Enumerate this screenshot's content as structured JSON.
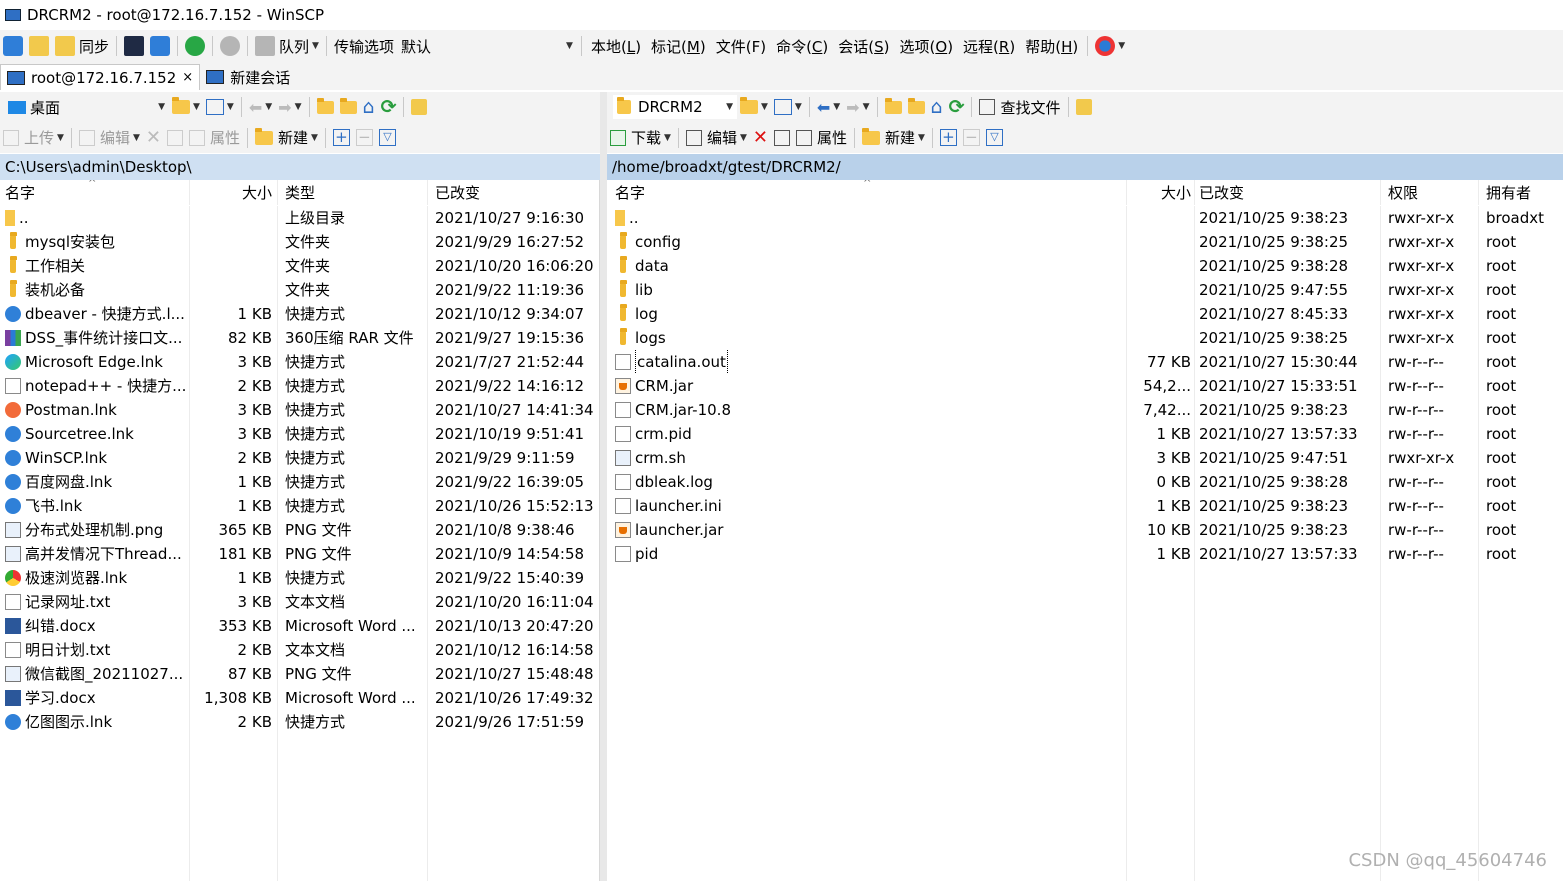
{
  "window": {
    "title": "DRCRM2 - root@172.16.7.152 - WinSCP"
  },
  "toolbar_main": {
    "sync_label": "同步",
    "queue_label": "队列",
    "transfer_options_label": "传输选项",
    "transfer_preset": "默认",
    "menus": [
      {
        "text": "本地(",
        "key": "L",
        "end": ")"
      },
      {
        "text": "标记(",
        "key": "M",
        "end": ")"
      },
      {
        "text": "文件(F)",
        "key": "",
        "end": ""
      },
      {
        "text": "命令(",
        "key": "C",
        "end": ")"
      },
      {
        "text": "会话(",
        "key": "S",
        "end": ")"
      },
      {
        "text": "选项(",
        "key": "O",
        "end": ")"
      },
      {
        "text": "远程(",
        "key": "R",
        "end": ")"
      },
      {
        "text": "帮助(",
        "key": "H",
        "end": ")"
      }
    ]
  },
  "tabs": [
    {
      "label": "root@172.16.7.152",
      "close": "×"
    },
    {
      "label": "新建会话"
    }
  ],
  "left_panel": {
    "location": "桌面",
    "upload_label": "上传",
    "edit_label": "编辑",
    "properties_label": "属性",
    "new_label": "新建",
    "path": "C:\\Users\\admin\\Desktop\\",
    "columns": {
      "name": "名字",
      "size": "大小",
      "type": "类型",
      "changed": "已改变"
    },
    "rows": [
      {
        "icon": "up",
        "name": "..",
        "size": "",
        "type": "上级目录",
        "changed": "2021/10/27  9:16:30"
      },
      {
        "icon": "folder",
        "name": "mysql安装包",
        "size": "",
        "type": "文件夹",
        "changed": "2021/9/29  16:27:52"
      },
      {
        "icon": "folder",
        "name": "工作相关",
        "size": "",
        "type": "文件夹",
        "changed": "2021/10/20  16:06:20"
      },
      {
        "icon": "folder",
        "name": "装机必备",
        "size": "",
        "type": "文件夹",
        "changed": "2021/9/22  11:19:36"
      },
      {
        "icon": "lnk-blue",
        "name": "dbeaver - 快捷方式.l...",
        "size": "1 KB",
        "type": "快捷方式",
        "changed": "2021/10/12  9:34:07"
      },
      {
        "icon": "rar",
        "name": "DSS_事件统计接口文...",
        "size": "82 KB",
        "type": "360压缩 RAR 文件",
        "changed": "2021/9/27  19:15:36"
      },
      {
        "icon": "lnk-green",
        "name": "Microsoft Edge.lnk",
        "size": "3 KB",
        "type": "快捷方式",
        "changed": "2021/7/27  21:52:44"
      },
      {
        "icon": "doc",
        "name": "notepad++ - 快捷方...",
        "size": "2 KB",
        "type": "快捷方式",
        "changed": "2021/9/22  14:16:12"
      },
      {
        "icon": "lnk-orange",
        "name": "Postman.lnk",
        "size": "3 KB",
        "type": "快捷方式",
        "changed": "2021/10/27  14:41:34"
      },
      {
        "icon": "lnk-blue",
        "name": "Sourcetree.lnk",
        "size": "3 KB",
        "type": "快捷方式",
        "changed": "2021/10/19  9:51:41"
      },
      {
        "icon": "lnk-blue",
        "name": "WinSCP.lnk",
        "size": "2 KB",
        "type": "快捷方式",
        "changed": "2021/9/29  9:11:59"
      },
      {
        "icon": "lnk-blue",
        "name": "百度网盘.lnk",
        "size": "1 KB",
        "type": "快捷方式",
        "changed": "2021/9/22  16:39:05"
      },
      {
        "icon": "lnk-blue",
        "name": "飞书.lnk",
        "size": "1 KB",
        "type": "快捷方式",
        "changed": "2021/10/26  15:52:13"
      },
      {
        "icon": "png",
        "name": "分布式处理机制.png",
        "size": "365 KB",
        "type": "PNG 文件",
        "changed": "2021/10/8  9:38:46"
      },
      {
        "icon": "png",
        "name": "高并发情况下Thread...",
        "size": "181 KB",
        "type": "PNG 文件",
        "changed": "2021/10/9  14:54:58"
      },
      {
        "icon": "lnk-chrome",
        "name": "极速浏览器.lnk",
        "size": "1 KB",
        "type": "快捷方式",
        "changed": "2021/9/22  15:40:39"
      },
      {
        "icon": "doc",
        "name": "记录网址.txt",
        "size": "3 KB",
        "type": "文本文档",
        "changed": "2021/10/20  16:11:04"
      },
      {
        "icon": "word",
        "name": "纠错.docx",
        "size": "353 KB",
        "type": "Microsoft Word ...",
        "changed": "2021/10/13  20:47:20"
      },
      {
        "icon": "doc",
        "name": "明日计划.txt",
        "size": "2 KB",
        "type": "文本文档",
        "changed": "2021/10/12  16:14:58"
      },
      {
        "icon": "png",
        "name": "微信截图_20211027...",
        "size": "87 KB",
        "type": "PNG 文件",
        "changed": "2021/10/27  15:48:48"
      },
      {
        "icon": "word",
        "name": "学习.docx",
        "size": "1,308 KB",
        "type": "Microsoft Word ...",
        "changed": "2021/10/26  17:49:32"
      },
      {
        "icon": "lnk-blue",
        "name": "亿图图示.lnk",
        "size": "2 KB",
        "type": "快捷方式",
        "changed": "2021/9/26  17:51:59"
      }
    ]
  },
  "right_panel": {
    "location": "DRCRM2",
    "find_files_label": "查找文件",
    "download_label": "下载",
    "edit_label": "编辑",
    "properties_label": "属性",
    "new_label": "新建",
    "path": "/home/broadxt/gtest/DRCRM2/",
    "columns": {
      "name": "名字",
      "size": "大小",
      "changed": "已改变",
      "rights": "权限",
      "owner": "拥有者"
    },
    "rows": [
      {
        "icon": "up",
        "name": "..",
        "size": "",
        "changed": "2021/10/25 9:38:23",
        "rights": "rwxr-xr-x",
        "owner": "broadxt"
      },
      {
        "icon": "folder",
        "name": "config",
        "size": "",
        "changed": "2021/10/25 9:38:25",
        "rights": "rwxr-xr-x",
        "owner": "root"
      },
      {
        "icon": "folder",
        "name": "data",
        "size": "",
        "changed": "2021/10/25 9:38:28",
        "rights": "rwxr-xr-x",
        "owner": "root"
      },
      {
        "icon": "folder",
        "name": "lib",
        "size": "",
        "changed": "2021/10/25 9:47:55",
        "rights": "rwxr-xr-x",
        "owner": "root"
      },
      {
        "icon": "folder",
        "name": "log",
        "size": "",
        "changed": "2021/10/27 8:45:33",
        "rights": "rwxr-xr-x",
        "owner": "root"
      },
      {
        "icon": "folder",
        "name": "logs",
        "size": "",
        "changed": "2021/10/25 9:38:25",
        "rights": "rwxr-xr-x",
        "owner": "root"
      },
      {
        "icon": "doc",
        "name": "catalina.out",
        "size": "77 KB",
        "changed": "2021/10/27 15:30:44",
        "rights": "rw-r--r--",
        "owner": "root",
        "selected": true
      },
      {
        "icon": "jar",
        "name": "CRM.jar",
        "size": "54,2...",
        "changed": "2021/10/27 15:33:51",
        "rights": "rw-r--r--",
        "owner": "root"
      },
      {
        "icon": "doc",
        "name": "CRM.jar-10.8",
        "size": "7,42...",
        "changed": "2021/10/25 9:38:23",
        "rights": "rw-r--r--",
        "owner": "root"
      },
      {
        "icon": "doc",
        "name": "crm.pid",
        "size": "1 KB",
        "changed": "2021/10/27 13:57:33",
        "rights": "rw-r--r--",
        "owner": "root"
      },
      {
        "icon": "png",
        "name": "crm.sh",
        "size": "3 KB",
        "changed": "2021/10/25 9:47:51",
        "rights": "rwxr-xr-x",
        "owner": "root"
      },
      {
        "icon": "doc",
        "name": "dbleak.log",
        "size": "0 KB",
        "changed": "2021/10/25 9:38:28",
        "rights": "rw-r--r--",
        "owner": "root"
      },
      {
        "icon": "doc",
        "name": "launcher.ini",
        "size": "1 KB",
        "changed": "2021/10/25 9:38:23",
        "rights": "rw-r--r--",
        "owner": "root"
      },
      {
        "icon": "jar",
        "name": "launcher.jar",
        "size": "10 KB",
        "changed": "2021/10/25 9:38:23",
        "rights": "rw-r--r--",
        "owner": "root"
      },
      {
        "icon": "doc",
        "name": "pid",
        "size": "1 KB",
        "changed": "2021/10/27 13:57:33",
        "rights": "rw-r--r--",
        "owner": "root"
      }
    ]
  },
  "watermark": "CSDN @qq_45604746"
}
